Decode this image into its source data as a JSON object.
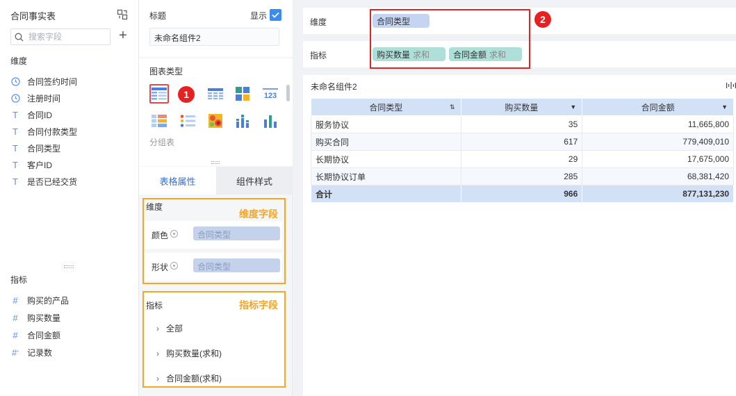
{
  "left_panel": {
    "title": "合同事实表",
    "search_placeholder": "搜索字段",
    "dimension_label": "维度",
    "dimensions": [
      {
        "type": "clock",
        "name": "合同签约时间"
      },
      {
        "type": "clock",
        "name": "注册时间"
      },
      {
        "type": "text",
        "name": "合同ID"
      },
      {
        "type": "text",
        "name": "合同付款类型"
      },
      {
        "type": "text",
        "name": "合同类型"
      },
      {
        "type": "text",
        "name": "客户ID"
      },
      {
        "type": "text",
        "name": "是否已经交货"
      }
    ],
    "metric_label": "指标",
    "metrics": [
      {
        "type": "number",
        "name": "购买的产品"
      },
      {
        "type": "number",
        "name": "购买数量"
      },
      {
        "type": "number",
        "name": "合同金额"
      },
      {
        "type": "number-star",
        "name": "记录数"
      }
    ]
  },
  "config_panel": {
    "title_label": "标题",
    "show_label": "显示",
    "show_checked": true,
    "component_name": "未命名组件2",
    "chart_type_label": "图表类型",
    "group_table_label": "分组表",
    "badge1": "1",
    "tabs": {
      "active": "表格属性",
      "inactive": "组件样式"
    },
    "dimension_box": {
      "label": "维度",
      "annotation": "维度字段",
      "rows": [
        {
          "label": "颜色",
          "field": "合同类型"
        },
        {
          "label": "形状",
          "field": "合同类型"
        }
      ]
    },
    "metric_box": {
      "label": "指标",
      "annotation": "指标字段",
      "items": [
        "全部",
        "购买数量(求和)",
        "合同金额(求和)"
      ]
    }
  },
  "preview": {
    "dimension_shelf_label": "维度",
    "dimension_chip": "合同类型",
    "metric_shelf_label": "指标",
    "metric_chips": [
      {
        "name": "购买数量",
        "agg": "求和"
      },
      {
        "name": "合同金额",
        "agg": "求和"
      }
    ],
    "badge2": "2",
    "card_title": "未命名组件2",
    "table": {
      "headers": [
        "合同类型",
        "购买数量",
        "合同金额"
      ],
      "rows": [
        [
          "服务协议",
          "35",
          "11,665,800"
        ],
        [
          "购买合同",
          "617",
          "779,409,010"
        ],
        [
          "长期协议",
          "29",
          "17,675,000"
        ],
        [
          "长期协议订单",
          "285",
          "68,381,420"
        ]
      ],
      "total": [
        "合计",
        "966",
        "877,131,230"
      ]
    }
  },
  "colors": {
    "accent_blue": "#3c8cf0",
    "highlight_red": "#e52121",
    "annotation_orange": "#f5a623",
    "dimension_chip": "#c5d4f1",
    "metric_chip": "#aee0d9",
    "table_header": "#d3e1f7"
  }
}
